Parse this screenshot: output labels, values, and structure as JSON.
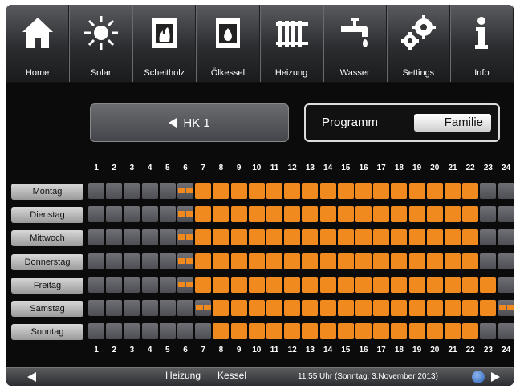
{
  "nav": {
    "items": [
      {
        "label": "Home",
        "icon": "home-icon"
      },
      {
        "label": "Solar",
        "icon": "sun-icon"
      },
      {
        "label": "Scheitholz",
        "icon": "wood-stove-icon"
      },
      {
        "label": "Ölkessel",
        "icon": "oil-boiler-icon"
      },
      {
        "label": "Heizung",
        "icon": "radiator-icon"
      },
      {
        "label": "Wasser",
        "icon": "water-tap-icon"
      },
      {
        "label": "Settings",
        "icon": "gears-icon"
      },
      {
        "label": "Info",
        "icon": "info-icon"
      }
    ]
  },
  "circuit": {
    "label": "HK 1"
  },
  "program": {
    "label": "Programm",
    "value": "Familie"
  },
  "hours": [
    "1",
    "2",
    "3",
    "4",
    "5",
    "6",
    "7",
    "8",
    "9",
    "10",
    "11",
    "12",
    "13",
    "14",
    "15",
    "16",
    "17",
    "18",
    "19",
    "20",
    "21",
    "22",
    "23",
    "24"
  ],
  "days": [
    {
      "label": "Montag",
      "slots": "000001111111111111111111000"
    },
    {
      "label": "Dienstag",
      "slots": ""
    },
    {
      "label": "Mittwoch",
      "slots": ""
    },
    {
      "label": "Donnerstag",
      "slots": ""
    },
    {
      "label": "Freitag",
      "slots": ""
    },
    {
      "label": "Samstag",
      "slots": ""
    },
    {
      "label": "Sonntag",
      "slots": ""
    }
  ],
  "schedule": [
    [
      "off",
      "off",
      "off",
      "off",
      "off",
      "half-right",
      "on",
      "on",
      "on",
      "on",
      "on",
      "on",
      "on",
      "on",
      "on",
      "on",
      "on",
      "on",
      "on",
      "on",
      "on",
      "on",
      "off",
      "off"
    ],
    [
      "off",
      "off",
      "off",
      "off",
      "off",
      "half-right",
      "on",
      "on",
      "on",
      "on",
      "on",
      "on",
      "on",
      "on",
      "on",
      "on",
      "on",
      "on",
      "on",
      "on",
      "on",
      "on",
      "off",
      "off"
    ],
    [
      "off",
      "off",
      "off",
      "off",
      "off",
      "half-right",
      "on",
      "on",
      "on",
      "on",
      "on",
      "on",
      "on",
      "on",
      "on",
      "on",
      "on",
      "on",
      "on",
      "on",
      "on",
      "on",
      "off",
      "off"
    ],
    [
      "off",
      "off",
      "off",
      "off",
      "off",
      "half-right",
      "on",
      "on",
      "on",
      "on",
      "on",
      "on",
      "on",
      "on",
      "on",
      "on",
      "on",
      "on",
      "on",
      "on",
      "on",
      "on",
      "off",
      "off"
    ],
    [
      "off",
      "off",
      "off",
      "off",
      "off",
      "half-right",
      "on",
      "on",
      "on",
      "on",
      "on",
      "on",
      "on",
      "on",
      "on",
      "on",
      "on",
      "on",
      "on",
      "on",
      "on",
      "on",
      "on",
      "off"
    ],
    [
      "off",
      "off",
      "off",
      "off",
      "off",
      "off",
      "half-right",
      "on",
      "on",
      "on",
      "on",
      "on",
      "on",
      "on",
      "on",
      "on",
      "on",
      "on",
      "on",
      "on",
      "on",
      "on",
      "on",
      "half-right"
    ],
    [
      "off",
      "off",
      "off",
      "off",
      "off",
      "off",
      "off",
      "on",
      "on",
      "on",
      "on",
      "on",
      "on",
      "on",
      "on",
      "on",
      "on",
      "on",
      "on",
      "on",
      "on",
      "on",
      "off",
      "off"
    ]
  ],
  "bottom": {
    "tab_heizung": "Heizung",
    "tab_kessel": "Kessel",
    "status": "11:55 Uhr (Sonntag, 3.November 2013)"
  },
  "colors": {
    "active": "#f08a1e",
    "inactive": "#5e5f64"
  }
}
